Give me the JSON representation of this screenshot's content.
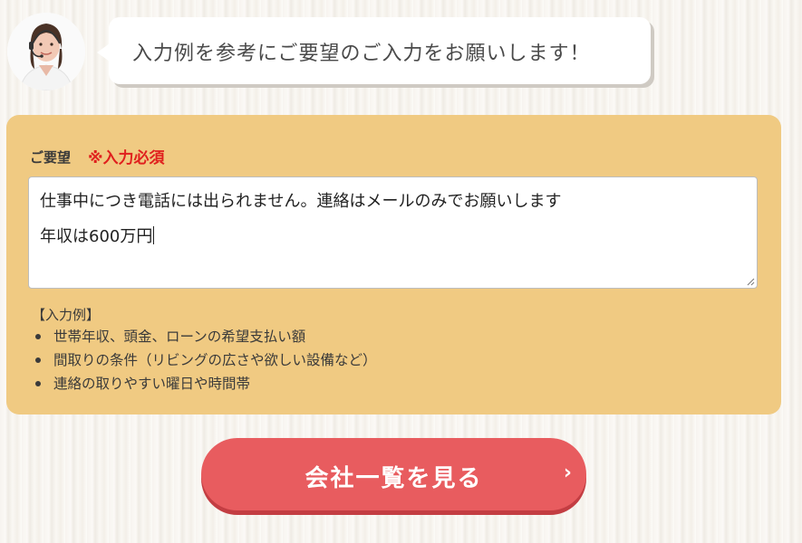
{
  "operator": {
    "avatar_icon": "operator-headset-avatar",
    "message": "入力例を参考にご要望のご入力をお願いします！"
  },
  "form": {
    "field_label": "ご要望",
    "required_label": "※入力必須",
    "textarea_lines": [
      "仕事中につき電話には出られません。連絡はメールのみでお願いします",
      "年収は600万円"
    ],
    "example_title": "【入力例】",
    "examples": [
      "世帯年収、頭金、ローンの希望支払い額",
      "間取りの条件（リビングの広さや欲しい設備など）",
      "連絡の取りやすい曜日や時間帯"
    ]
  },
  "cta": {
    "label": "会社一覧を見る",
    "arrow": "›"
  },
  "colors": {
    "panel": "#f0ca82",
    "required": "#e0201e",
    "button": "#e85c5f"
  }
}
